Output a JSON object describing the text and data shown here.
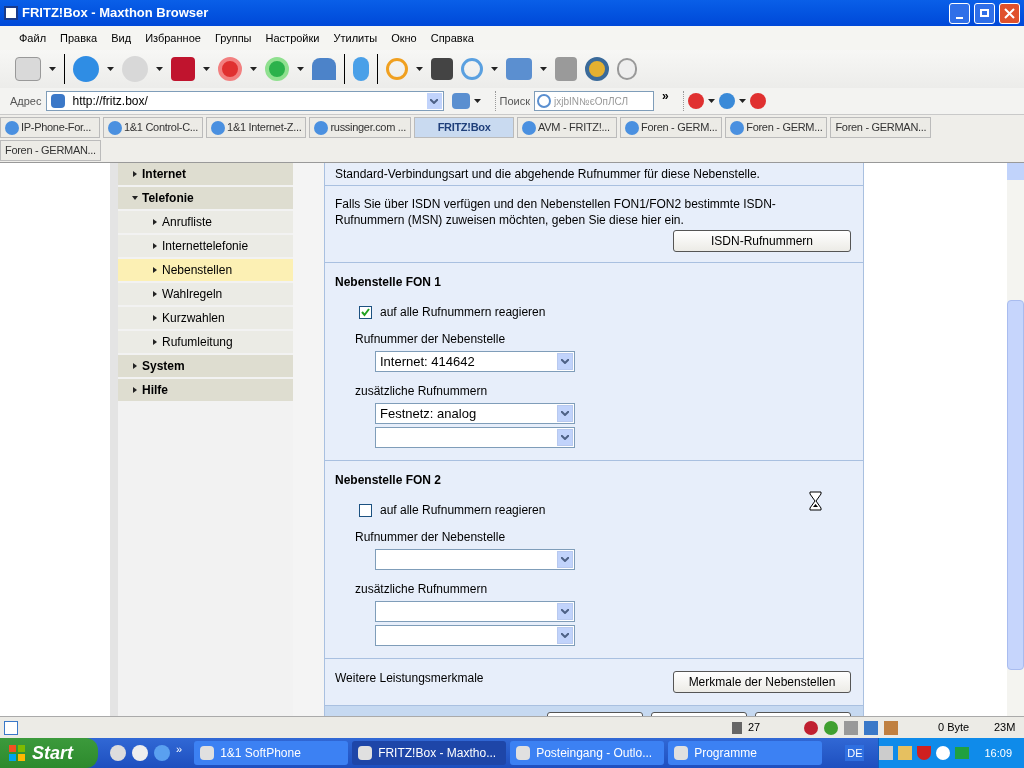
{
  "window": {
    "title": "FRITZ!Box - Maxthon Browser"
  },
  "menu": [
    "Файл",
    "Правка",
    "Вид",
    "Избранное",
    "Группы",
    "Настройки",
    "Утилиты",
    "Окно",
    "Справка"
  ],
  "address": {
    "label": "Адрес",
    "value": "http://fritz.box/"
  },
  "search": {
    "label": "Поиск",
    "placeholder": "jxjbIN№єОпЛСЛ",
    "more": "»"
  },
  "tabs": [
    {
      "label": "IP-Phone-For...",
      "selected": false
    },
    {
      "label": "1&1 Control-C...",
      "selected": false
    },
    {
      "label": "1&1 Internet-Z...",
      "selected": false
    },
    {
      "label": "russinger.com ...",
      "selected": false
    },
    {
      "label": "FRITZ!Box",
      "selected": true
    },
    {
      "label": "AVM - FRITZ!...",
      "selected": false
    },
    {
      "label": "Foren - GERM...",
      "selected": false
    },
    {
      "label": "Foren - GERM...",
      "selected": false
    },
    {
      "label": "Foren - GERMAN...",
      "selected": false
    },
    {
      "label": "Foren - GERMAN...",
      "selected": false
    }
  ],
  "sidebar": {
    "items": [
      {
        "label": "Internet",
        "expanded": false,
        "selected": false
      },
      {
        "label": "Telefonie",
        "expanded": true,
        "selected": false,
        "children": [
          {
            "label": "Anrufliste",
            "selected": false
          },
          {
            "label": "Internettelefonie",
            "selected": false
          },
          {
            "label": "Nebenstellen",
            "selected": true
          },
          {
            "label": "Wahlregeln",
            "selected": false
          },
          {
            "label": "Kurzwahlen",
            "selected": false
          },
          {
            "label": "Rufumleitung",
            "selected": false
          }
        ]
      },
      {
        "label": "System",
        "expanded": false,
        "selected": false
      },
      {
        "label": "Hilfe",
        "expanded": false,
        "selected": false
      }
    ]
  },
  "intro": "Standard-Verbindungsart und die abgehende Rufnummer für diese Nebenstelle.",
  "isdn": {
    "text": "Falls Sie über ISDN verfügen und den Nebenstellen FON1/FON2 bestimmte ISDN-Rufnummern (MSN) zuweisen möchten, geben Sie diese hier ein.",
    "button": "ISDN-Rufnummern"
  },
  "extensions": [
    {
      "title": "Nebenstelle FON 1",
      "checkbox": {
        "label": "auf alle Rufnummern reagieren",
        "checked": true
      },
      "number_label": "Rufnummer der Nebenstelle",
      "number": {
        "kind": "filled",
        "value": "Internet: 414642"
      },
      "extra_label": "zusätzliche Rufnummern",
      "extra": [
        {
          "kind": "filled",
          "value": "Festnetz: analog"
        },
        {
          "kind": "blank"
        }
      ]
    },
    {
      "title": "Nebenstelle FON 2",
      "checkbox": {
        "label": "auf alle Rufnummern reagieren",
        "checked": false
      },
      "number_label": "Rufnummer der Nebenstelle",
      "number": {
        "kind": "blank"
      },
      "extra_label": "zusätzliche Rufnummern",
      "extra": [
        {
          "kind": "blank"
        },
        {
          "kind": "blank"
        }
      ]
    }
  ],
  "features": {
    "label": "Weitere Leistungsmerkmale",
    "button": "Merkmale der Nebenstellen"
  },
  "status_bar": {
    "trash_count": "27",
    "traffic": "0 Byte",
    "memory": "23M"
  },
  "taskbar": {
    "start": "Start",
    "more": "»",
    "tasks": [
      {
        "label": "1&1 SoftPhone",
        "selected": false
      },
      {
        "label": "FRITZ!Box - Maxtho...",
        "selected": true
      },
      {
        "label": "Posteingang - Outlo...",
        "selected": false
      },
      {
        "label": "Programme",
        "selected": false
      }
    ],
    "language": "DE",
    "time": "16:09"
  }
}
